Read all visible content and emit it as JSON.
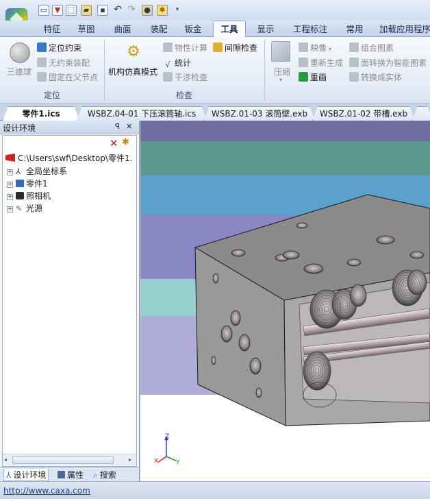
{
  "ribbon_tabs": [
    "特征",
    "草图",
    "曲面",
    "装配",
    "钣金",
    "工具",
    "显示",
    "工程标注",
    "常用",
    "加载应用程序"
  ],
  "active_tab": "工具",
  "ribbon": {
    "group_locate": {
      "label": "定位",
      "big_button": "三维球",
      "locate_constraint": "定位约束",
      "no_constraint_assembly": "无约束装配",
      "fix_in_parent": "固定在父节点"
    },
    "mechanism_sim": "机构仿真模式",
    "group_check": {
      "label": "检查",
      "physical_calc": "物性计算",
      "statistics": "统计",
      "gap_check": "间隙检查",
      "interference_check": "干涉检查"
    },
    "compress": "压缩",
    "mapping": "映像",
    "regenerate": "重新生成",
    "redraw": "重画",
    "combine_pattern": "组合图素",
    "convert_smart": "面转换为智能图素",
    "convert_solid": "转换成实体"
  },
  "doc_tabs": [
    "零件1.ics",
    "WSBZ.04-01 下压滚筒轴.ics",
    "WSBZ.01-03 滚筒壁.exb",
    "WSBZ.01-02 带槽.exb"
  ],
  "panel": {
    "title": "设计环境",
    "pin": "ꟼ",
    "close": "✕",
    "root_path": "C:\\Users\\swf\\Desktop\\零件1.",
    "tree_items": [
      "全局坐标系",
      "零件1",
      "照相机",
      "光源"
    ],
    "bottom_tabs": [
      "设计环境",
      "属性",
      "搜索"
    ]
  },
  "viewport": {
    "axis_labels": {
      "z": "Z",
      "x": "X",
      "y": "Y"
    },
    "band_colors": [
      "#706ea0",
      "#5b9890",
      "#5ca0cc",
      "#8a88c4",
      "#98d0d0",
      "#b0acd8"
    ]
  },
  "status": {
    "link": "http://www.caxa.com"
  }
}
